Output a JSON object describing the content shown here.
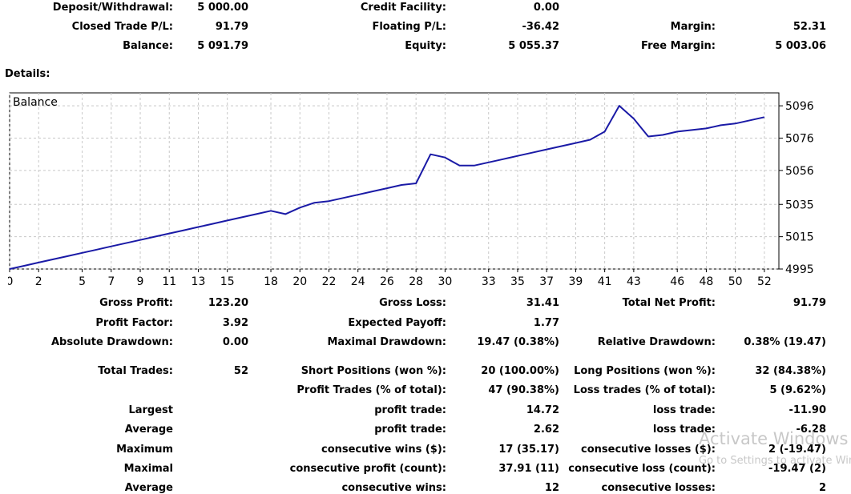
{
  "summary": {
    "rows": [
      [
        {
          "label": "Deposit/Withdrawal:",
          "value": "5 000.00"
        },
        {
          "label": "Credit Facility:",
          "value": "0.00"
        },
        {
          "label": "",
          "value": ""
        }
      ],
      [
        {
          "label": "Closed Trade P/L:",
          "value": "91.79"
        },
        {
          "label": "Floating P/L:",
          "value": "-36.42"
        },
        {
          "label": "Margin:",
          "value": "52.31"
        }
      ],
      [
        {
          "label": "Balance:",
          "value": "5 091.79"
        },
        {
          "label": "Equity:",
          "value": "5 055.37"
        },
        {
          "label": "Free Margin:",
          "value": "5 003.06"
        }
      ]
    ]
  },
  "details_label": "Details:",
  "chart_data": {
    "type": "line",
    "title": "Balance",
    "line_color": "#1a1aa6",
    "grid": true,
    "xlim": [
      0,
      53
    ],
    "ylim": [
      4995,
      5104
    ],
    "x_ticks": [
      0,
      2,
      5,
      7,
      9,
      11,
      13,
      15,
      18,
      20,
      22,
      24,
      26,
      28,
      30,
      33,
      35,
      37,
      39,
      41,
      43,
      46,
      48,
      50,
      52
    ],
    "y_ticks": [
      4995,
      5015,
      5035,
      5056,
      5076,
      5096
    ],
    "x": [
      0,
      1,
      2,
      3,
      4,
      5,
      6,
      7,
      8,
      9,
      10,
      11,
      12,
      13,
      14,
      15,
      16,
      17,
      18,
      19,
      20,
      21,
      22,
      23,
      24,
      25,
      26,
      27,
      28,
      29,
      30,
      31,
      32,
      33,
      34,
      35,
      36,
      37,
      38,
      39,
      40,
      41,
      42,
      43,
      44,
      45,
      46,
      47,
      48,
      49,
      50,
      51,
      52
    ],
    "values": [
      4995,
      4997,
      4999,
      5001,
      5003,
      5005,
      5007,
      5009,
      5011,
      5013,
      5015,
      5017,
      5019,
      5021,
      5023,
      5025,
      5027,
      5029,
      5031,
      5029,
      5033,
      5036,
      5037,
      5039,
      5041,
      5043,
      5045,
      5047,
      5048,
      5066,
      5064,
      5059,
      5059,
      5061,
      5063,
      5065,
      5067,
      5069,
      5071,
      5073,
      5075,
      5080,
      5096,
      5088,
      5077,
      5078,
      5080,
      5081,
      5082,
      5084,
      5085,
      5087,
      5089
    ]
  },
  "stats": {
    "rows": [
      [
        {
          "label": "Gross Profit:",
          "value": "123.20"
        },
        {
          "label": "Gross Loss:",
          "value": "31.41"
        },
        {
          "label": "Total Net Profit:",
          "value": "91.79"
        }
      ],
      [
        {
          "label": "Profit Factor:",
          "value": "3.92"
        },
        {
          "label": "Expected Payoff:",
          "value": "1.77"
        },
        {
          "label": "",
          "value": ""
        }
      ],
      [
        {
          "label": "Absolute Drawdown:",
          "value": "0.00"
        },
        {
          "label": "Maximal Drawdown:",
          "value": "19.47 (0.38%)"
        },
        {
          "label": "Relative Drawdown:",
          "value": "0.38% (19.47)"
        }
      ],
      [
        {
          "label": "Total Trades:",
          "value": "52"
        },
        {
          "label": "Short Positions (won %):",
          "value": "20 (100.00%)"
        },
        {
          "label": "Long Positions (won %):",
          "value": "32 (84.38%)"
        }
      ],
      [
        {
          "label": "",
          "value": ""
        },
        {
          "label": "Profit Trades (% of total):",
          "value": "47 (90.38%)"
        },
        {
          "label": "Loss trades (% of total):",
          "value": "5 (9.62%)"
        }
      ],
      [
        {
          "label": "Largest",
          "value": ""
        },
        {
          "label": "profit trade:",
          "value": "14.72"
        },
        {
          "label": "loss trade:",
          "value": "-11.90"
        }
      ],
      [
        {
          "label": "Average",
          "value": ""
        },
        {
          "label": "profit trade:",
          "value": "2.62"
        },
        {
          "label": "loss trade:",
          "value": "-6.28"
        }
      ],
      [
        {
          "label": "Maximum",
          "value": ""
        },
        {
          "label": "consecutive wins ($):",
          "value": "17 (35.17)"
        },
        {
          "label": "consecutive losses ($):",
          "value": "2 (-19.47)"
        }
      ],
      [
        {
          "label": "Maximal",
          "value": ""
        },
        {
          "label": "consecutive profit (count):",
          "value": "37.91 (11)"
        },
        {
          "label": "consecutive loss (count):",
          "value": "-19.47 (2)"
        }
      ],
      [
        {
          "label": "Average",
          "value": ""
        },
        {
          "label": "consecutive wins:",
          "value": "12"
        },
        {
          "label": "consecutive losses:",
          "value": "2"
        }
      ]
    ]
  },
  "watermark": {
    "title": "Activate Windows",
    "subtitle": "Go to Settings to activate Windows."
  }
}
